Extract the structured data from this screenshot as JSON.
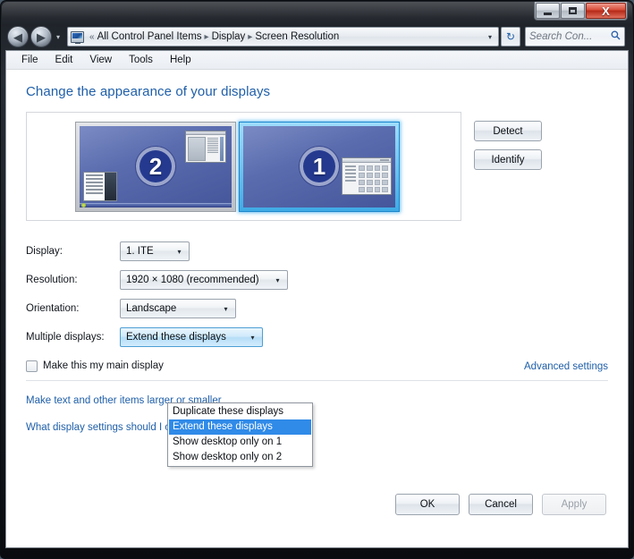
{
  "window": {
    "controls": {
      "minimize": "–",
      "maximize": "□",
      "close": "X"
    }
  },
  "nav": {
    "back_icon": "◀",
    "forward_icon": "▶",
    "history_icon": "▾",
    "address_icon": "display-icon",
    "breadcrumb_prefix": "«",
    "crumbs": [
      "All Control Panel Items",
      "Display",
      "Screen Resolution"
    ],
    "separator": "▸",
    "address_chevron": "▾",
    "refresh_icon": "↻",
    "search_placeholder": "Search Con...",
    "search_value": "",
    "search_icon": "🔍"
  },
  "menubar": {
    "items": [
      "File",
      "Edit",
      "View",
      "Tools",
      "Help"
    ]
  },
  "page": {
    "title": "Change the appearance of your displays"
  },
  "preview": {
    "monitors": [
      {
        "number": "2",
        "selected": false
      },
      {
        "number": "1",
        "selected": true
      }
    ],
    "detect_label": "Detect",
    "identify_label": "Identify"
  },
  "form": {
    "display": {
      "label": "Display:",
      "value": "1. ITE",
      "arrow": "▾"
    },
    "resolution": {
      "label": "Resolution:",
      "value": "1920 × 1080 (recommended)",
      "arrow": "▾"
    },
    "orientation": {
      "label": "Orientation:",
      "value": "Landscape",
      "arrow": "▾"
    },
    "multiple_displays": {
      "label": "Multiple displays:",
      "value": "Extend these displays",
      "arrow": "▾",
      "expanded": true,
      "options": [
        "Duplicate these displays",
        "Extend these displays",
        "Show desktop only on 1",
        "Show desktop only on 2"
      ],
      "selected_index": 1
    }
  },
  "options": {
    "main_display_label": "Make this my main display",
    "main_display_checked": false,
    "advanced_settings_link": "Advanced settings",
    "text_size_link": "Make text and other items larger or smaller",
    "help_link": "What display settings should I choose?"
  },
  "footer": {
    "ok_label": "OK",
    "cancel_label": "Cancel",
    "apply_label": "Apply",
    "apply_enabled": false
  },
  "colors": {
    "link": "#1f5fa9",
    "accent": "#2f8ae8",
    "selected_monitor_border": "#1d87cc",
    "close_button": "#c0392b"
  }
}
